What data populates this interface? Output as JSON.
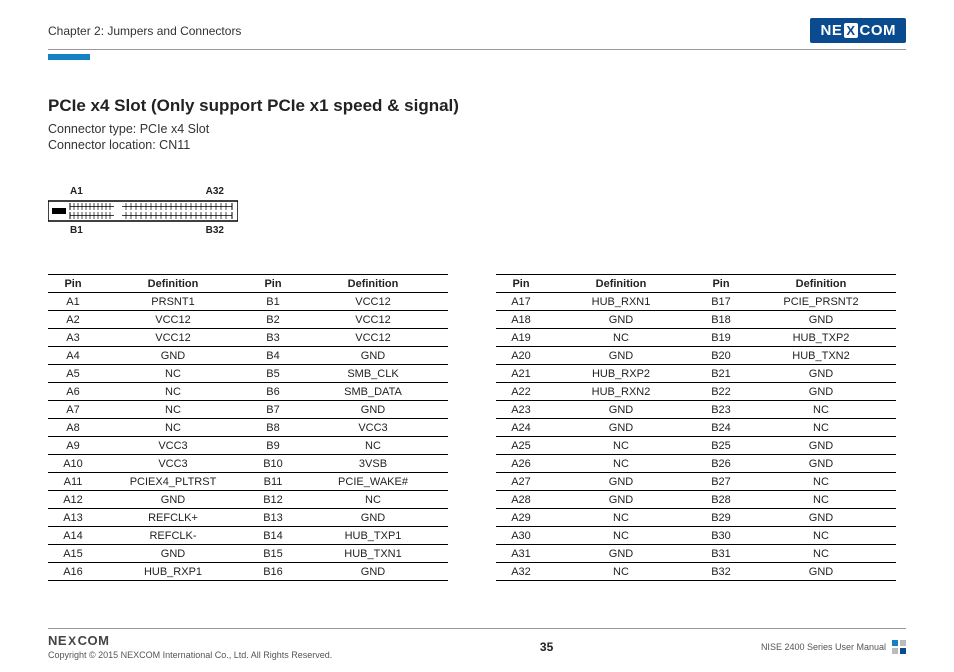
{
  "header": {
    "chapter": "Chapter 2: Jumpers and Connectors",
    "logo_text_before": "NE",
    "logo_text_x": "X",
    "logo_text_after": "COM"
  },
  "section": {
    "title": "PCIe x4 Slot (Only support PCIe x1 speed & signal)",
    "connector_type": "Connector type: PCIe x4 Slot",
    "connector_location": "Connector location: CN11"
  },
  "diagram": {
    "top_left": "A1",
    "top_right": "A32",
    "bot_left": "B1",
    "bot_right": "B32"
  },
  "table_headers": {
    "pin": "Pin",
    "definition": "Definition"
  },
  "table1": [
    {
      "pa": "A1",
      "da": "PRSNT1",
      "pb": "B1",
      "db": "VCC12"
    },
    {
      "pa": "A2",
      "da": "VCC12",
      "pb": "B2",
      "db": "VCC12"
    },
    {
      "pa": "A3",
      "da": "VCC12",
      "pb": "B3",
      "db": "VCC12"
    },
    {
      "pa": "A4",
      "da": "GND",
      "pb": "B4",
      "db": "GND"
    },
    {
      "pa": "A5",
      "da": "NC",
      "pb": "B5",
      "db": "SMB_CLK"
    },
    {
      "pa": "A6",
      "da": "NC",
      "pb": "B6",
      "db": "SMB_DATA"
    },
    {
      "pa": "A7",
      "da": "NC",
      "pb": "B7",
      "db": "GND"
    },
    {
      "pa": "A8",
      "da": "NC",
      "pb": "B8",
      "db": "VCC3"
    },
    {
      "pa": "A9",
      "da": "VCC3",
      "pb": "B9",
      "db": "NC"
    },
    {
      "pa": "A10",
      "da": "VCC3",
      "pb": "B10",
      "db": "3VSB"
    },
    {
      "pa": "A11",
      "da": "PCIEX4_PLTRST",
      "pb": "B11",
      "db": "PCIE_WAKE#"
    },
    {
      "pa": "A12",
      "da": "GND",
      "pb": "B12",
      "db": "NC"
    },
    {
      "pa": "A13",
      "da": "REFCLK+",
      "pb": "B13",
      "db": "GND"
    },
    {
      "pa": "A14",
      "da": "REFCLK-",
      "pb": "B14",
      "db": "HUB_TXP1"
    },
    {
      "pa": "A15",
      "da": "GND",
      "pb": "B15",
      "db": "HUB_TXN1"
    },
    {
      "pa": "A16",
      "da": "HUB_RXP1",
      "pb": "B16",
      "db": "GND"
    }
  ],
  "table2": [
    {
      "pa": "A17",
      "da": "HUB_RXN1",
      "pb": "B17",
      "db": "PCIE_PRSNT2"
    },
    {
      "pa": "A18",
      "da": "GND",
      "pb": "B18",
      "db": "GND"
    },
    {
      "pa": "A19",
      "da": "NC",
      "pb": "B19",
      "db": "HUB_TXP2"
    },
    {
      "pa": "A20",
      "da": "GND",
      "pb": "B20",
      "db": "HUB_TXN2"
    },
    {
      "pa": "A21",
      "da": "HUB_RXP2",
      "pb": "B21",
      "db": "GND"
    },
    {
      "pa": "A22",
      "da": "HUB_RXN2",
      "pb": "B22",
      "db": "GND"
    },
    {
      "pa": "A23",
      "da": "GND",
      "pb": "B23",
      "db": "NC"
    },
    {
      "pa": "A24",
      "da": "GND",
      "pb": "B24",
      "db": "NC"
    },
    {
      "pa": "A25",
      "da": "NC",
      "pb": "B25",
      "db": "GND"
    },
    {
      "pa": "A26",
      "da": "NC",
      "pb": "B26",
      "db": "GND"
    },
    {
      "pa": "A27",
      "da": "GND",
      "pb": "B27",
      "db": "NC"
    },
    {
      "pa": "A28",
      "da": "GND",
      "pb": "B28",
      "db": "NC"
    },
    {
      "pa": "A29",
      "da": "NC",
      "pb": "B29",
      "db": "GND"
    },
    {
      "pa": "A30",
      "da": "NC",
      "pb": "B30",
      "db": "NC"
    },
    {
      "pa": "A31",
      "da": "GND",
      "pb": "B31",
      "db": "NC"
    },
    {
      "pa": "A32",
      "da": "NC",
      "pb": "B32",
      "db": "GND"
    }
  ],
  "footer": {
    "copyright": "Copyright © 2015 NEXCOM International Co., Ltd. All Rights Reserved.",
    "page": "35",
    "manual": "NISE 2400 Series User Manual"
  }
}
